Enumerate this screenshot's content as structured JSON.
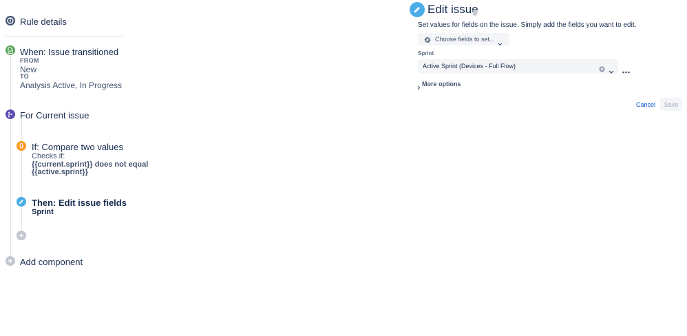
{
  "left_panel": {
    "rule_details": "Rule details",
    "trigger": {
      "title": "When: Issue transitioned",
      "from_label": "FROM",
      "from_value": "New",
      "to_label": "TO",
      "to_value": "Analysis Active, In Progress",
      "color": "#57a55a"
    },
    "branch": {
      "title": "For Current issue",
      "color": "#5e4db2"
    },
    "condition": {
      "title": "If: Compare two values",
      "checks_label": "Checks if:",
      "expression_line1": "{{current.sprint}} does not equal",
      "expression_line2": "{{active.sprint}}",
      "color": "#ff991f"
    },
    "action": {
      "title": "Then: Edit issue fields",
      "field": "Sprint",
      "color": "#4bade8"
    },
    "add_component": "Add component"
  },
  "right_panel": {
    "title": "Edit issue",
    "description": "Set values for fields on the issue. Simply add the fields you want to edit.",
    "choose_fields_label": "Choose fields to set...",
    "sprint_label": "Sprint",
    "sprint_value": "Active Sprint (Devices - Full Flow)",
    "more_options": "More options",
    "cancel": "Cancel",
    "save": "Save"
  }
}
